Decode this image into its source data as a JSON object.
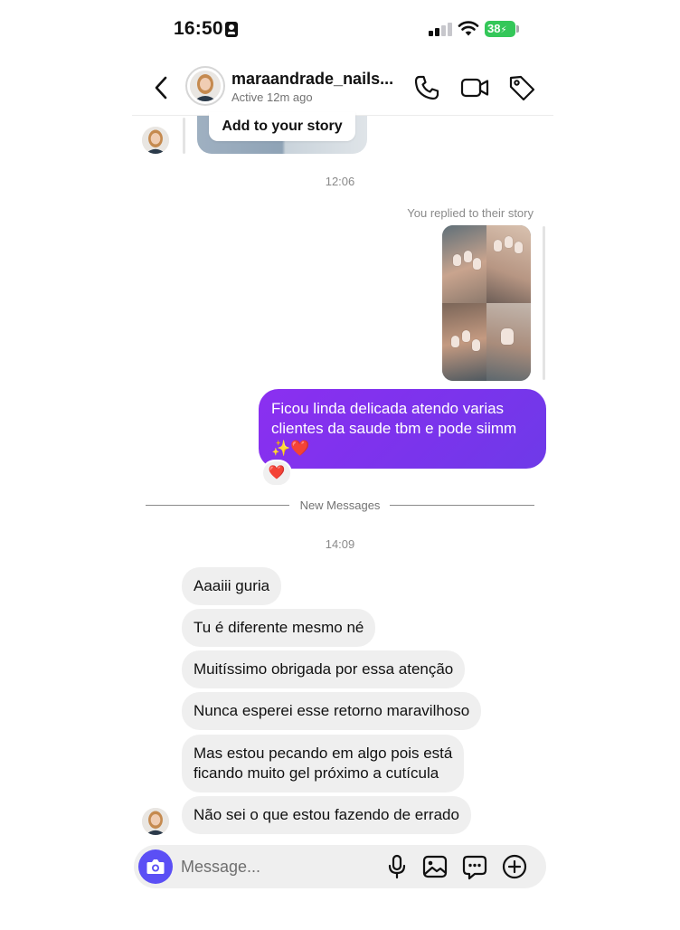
{
  "status_bar": {
    "time": "16:50",
    "battery": "38"
  },
  "header": {
    "username": "maraandrade_nails...",
    "status": "Active 12m ago"
  },
  "story": {
    "add_label": "Add to your story"
  },
  "timestamps": {
    "first": "12:06",
    "second": "14:09"
  },
  "sent": {
    "reply_label": "You replied to their story",
    "message": "Ficou linda delicada atendo varias clientes da saude tbm e pode siimm ✨❤️",
    "reaction": "❤️"
  },
  "divider": {
    "label": "New Messages"
  },
  "received": [
    "Aaaiii guria",
    "Tu é diferente mesmo né",
    "Muitíssimo obrigada por essa atenção",
    "Nunca esperei esse retorno maravilhoso",
    "Mas estou pecando em algo pois está\nficando muito gel próximo a cutícula",
    "Não sei o que estou fazendo de errado"
  ],
  "composer": {
    "placeholder": "Message..."
  },
  "colors": {
    "sent_bubble": "#7a34ec",
    "camera_button": "#5b4ff5",
    "received_bubble": "#efefef",
    "battery": "#34c759"
  },
  "icons": {
    "back": "chevron-left-icon",
    "call": "phone-icon",
    "video": "video-camera-icon",
    "tag": "tag-icon",
    "camera": "camera-icon",
    "mic": "microphone-icon",
    "gallery": "image-icon",
    "sticker": "chat-bubble-icon",
    "add": "plus-circle-icon"
  }
}
